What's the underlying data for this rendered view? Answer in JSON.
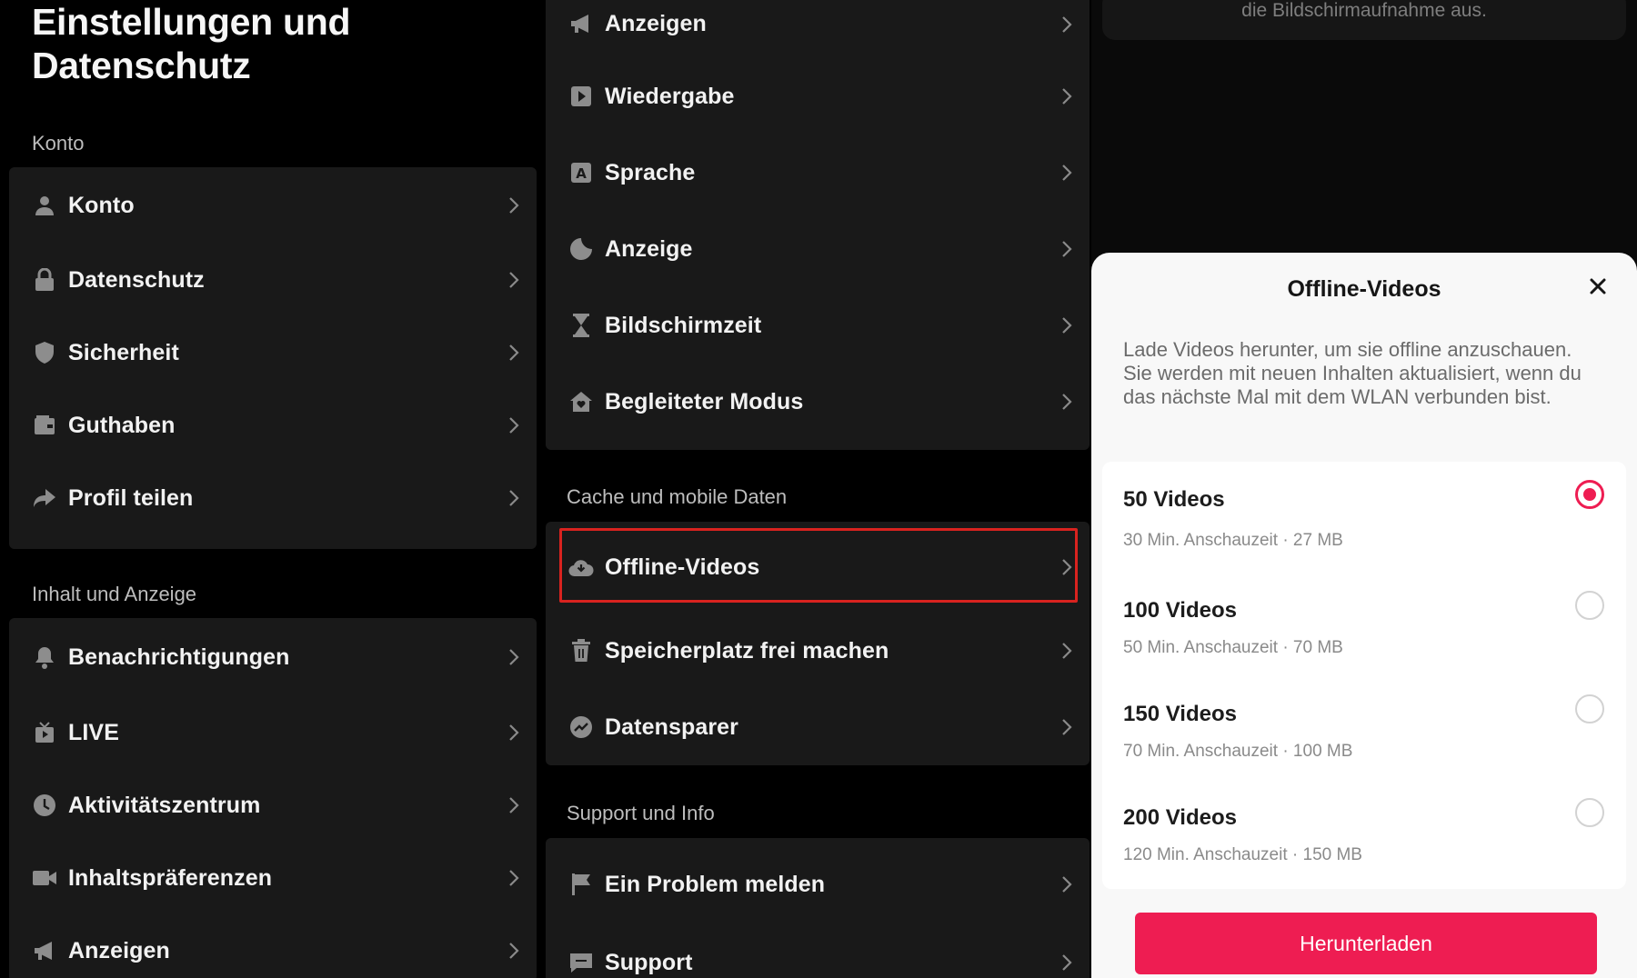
{
  "panel1": {
    "title_line1": "Einstellungen und",
    "title_line2": "Datenschutz",
    "sections": [
      {
        "label": "Konto",
        "items": [
          {
            "label": "Konto",
            "icon": "person-icon"
          },
          {
            "label": "Datenschutz",
            "icon": "lock-icon"
          },
          {
            "label": "Sicherheit",
            "icon": "shield-icon"
          },
          {
            "label": "Guthaben",
            "icon": "wallet-icon"
          },
          {
            "label": "Profil teilen",
            "icon": "share-icon"
          }
        ]
      },
      {
        "label": "Inhalt und Anzeige",
        "items": [
          {
            "label": "Benachrichtigungen",
            "icon": "bell-icon"
          },
          {
            "label": "LIVE",
            "icon": "live-tv-icon"
          },
          {
            "label": "Aktivitätszentrum",
            "icon": "clock-icon"
          },
          {
            "label": "Inhaltspräferenzen",
            "icon": "video-camera-icon"
          },
          {
            "label": "Anzeigen",
            "icon": "megaphone-icon"
          }
        ]
      }
    ]
  },
  "panel2": {
    "top_items": [
      {
        "label": "Anzeigen",
        "icon": "megaphone-icon"
      },
      {
        "label": "Wiedergabe",
        "icon": "play-icon"
      },
      {
        "label": "Sprache",
        "icon": "language-icon"
      },
      {
        "label": "Anzeige",
        "icon": "moon-icon"
      },
      {
        "label": "Bildschirmzeit",
        "icon": "hourglass-icon"
      },
      {
        "label": "Begleiteter Modus",
        "icon": "home-heart-icon"
      }
    ],
    "cache_section": {
      "label": "Cache und mobile Daten",
      "items": [
        {
          "label": "Offline-Videos",
          "icon": "cloud-download-icon"
        },
        {
          "label": "Speicherplatz frei machen",
          "icon": "trash-icon"
        },
        {
          "label": "Datensparer",
          "icon": "data-saver-icon"
        }
      ]
    },
    "support_section": {
      "label": "Support und Info",
      "items": [
        {
          "label": "Ein Problem melden",
          "icon": "flag-icon"
        },
        {
          "label": "Support",
          "icon": "chat-icon"
        }
      ]
    },
    "highlight_color": "#d9231f"
  },
  "panel3": {
    "top_note": "die Bildschirmaufnahme aus.",
    "sheet": {
      "title": "Offline-Videos",
      "description": "Lade Videos herunter, um sie offline anzuschauen. Sie werden mit neuen Inhalten aktualisiert, wenn du das nächste Mal mit dem WLAN verbunden bist.",
      "options": [
        {
          "title": "50 Videos",
          "subtitle": "30 Min. Anschauzeit · 27 MB",
          "selected": true
        },
        {
          "title": "100 Videos",
          "subtitle": "50 Min. Anschauzeit · 70 MB",
          "selected": false
        },
        {
          "title": "150 Videos",
          "subtitle": "70 Min. Anschauzeit · 100 MB",
          "selected": false
        },
        {
          "title": "200 Videos",
          "subtitle": "120 Min. Anschauzeit · 150 MB",
          "selected": false
        }
      ],
      "button_label": "Herunterladen",
      "accent_color": "#ee1d52"
    }
  }
}
